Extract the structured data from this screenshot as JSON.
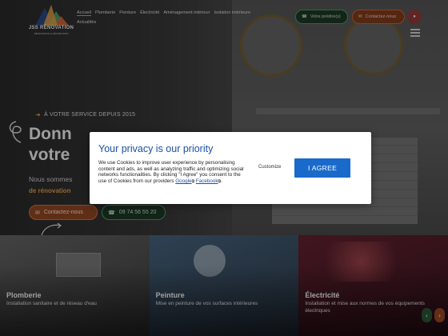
{
  "brand": {
    "name": "JSS RÉNOVATION",
    "tagline": "RÉNOVATION & DÉCORATION"
  },
  "nav": {
    "items": [
      "Accueil",
      "Plomberie",
      "Peinture",
      "Électricité",
      "Aménagement intérieur",
      "Isolation intérieure"
    ],
    "second_row": "Actualités"
  },
  "header": {
    "phone_label": "Votre prédire(s)",
    "contact_label": "Contactez-nous"
  },
  "hero": {
    "tagline": "À VOTRE SERVICE DEPUIS 2015",
    "headline_line1": "Donn",
    "headline_line1_tail": "votre",
    "intro": "Nous sommes",
    "intro_bold": "de rénovation",
    "cta_contact": "Contactez-nous",
    "cta_phone": "09 74 56 55 20"
  },
  "services": [
    {
      "title": "Plomberie",
      "desc": "Installation sanitaire et de réseau d'eau"
    },
    {
      "title": "Peinture",
      "desc": "Mise en peinture de vos surfaces intérieures"
    },
    {
      "title": "Électricité",
      "desc": "Installation et mise aux normes de vos équipements électriques"
    }
  ],
  "privacy": {
    "title": "Your privacy is our priority",
    "text": "We use Cookies to improve user experience by personalising content and ads, as well as analyzing traffic and optimizing social networks functionalities. By clicking \"I Agree\" you consent to the use of Cookies from our providers",
    "link_google": "Google",
    "link_facebook": "Facebook",
    "customize_label": "Customize",
    "agree_label": "I AGREE"
  },
  "colors": {
    "accent": "#e8a64a",
    "green": "#4ea36a",
    "orange": "#d56a3a",
    "primary_blue": "#1a6acb"
  }
}
